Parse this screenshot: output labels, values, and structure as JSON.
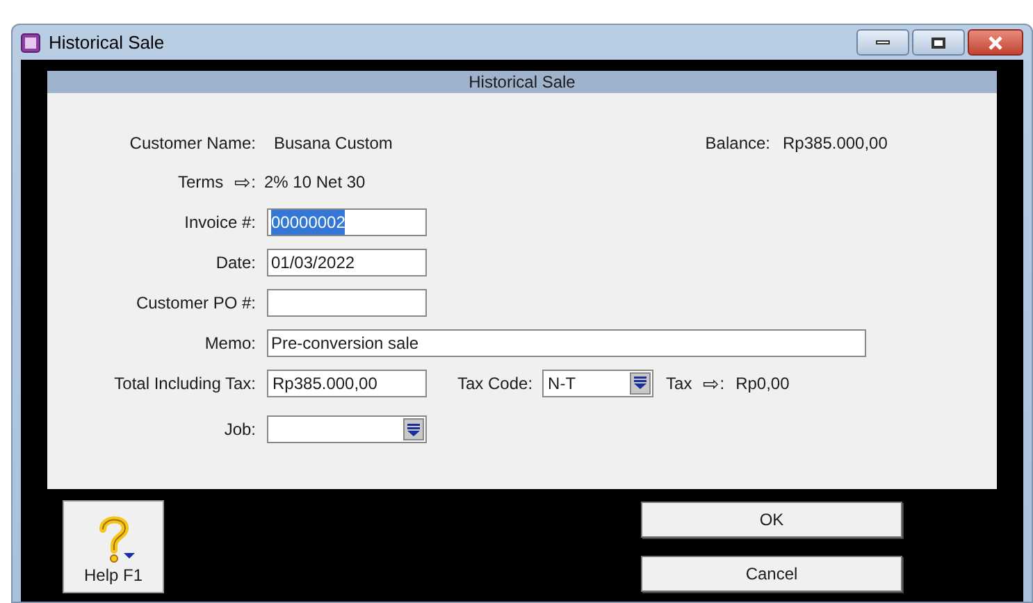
{
  "window": {
    "title": "Historical Sale"
  },
  "header": {
    "title": "Historical Sale"
  },
  "customer": {
    "label": "Customer Name:",
    "value": "Busana Custom"
  },
  "balance": {
    "label": "Balance:",
    "value": "Rp385.000,00"
  },
  "terms": {
    "label": "Terms",
    "arrow": "⇨",
    "colon": ":",
    "value": "2% 10 Net 30"
  },
  "fields": [
    {
      "kind": "input",
      "label": "Invoice #:",
      "value": "00000002",
      "selected": true
    },
    {
      "kind": "input",
      "label": "Date:",
      "value": "01/03/2022",
      "selected": false
    },
    {
      "kind": "input",
      "label": "Customer PO #:",
      "selected": false
    },
    {
      "kind": "wide_input",
      "label": "Memo:",
      "value": "Pre-conversion sale",
      "selected": false
    }
  ],
  "total": {
    "label": "Total Including Tax:",
    "value": "Rp385.000,00"
  },
  "tax_code": {
    "label": "Tax Code:",
    "value": "N-T"
  },
  "tax": {
    "label": "Tax",
    "arrow": "⇨",
    "colon": ":",
    "value": "Rp0,00"
  },
  "job": {
    "label": "Job:"
  },
  "help_button": {
    "label": "Help F1"
  },
  "buttons": [
    "OK",
    "Cancel"
  ]
}
